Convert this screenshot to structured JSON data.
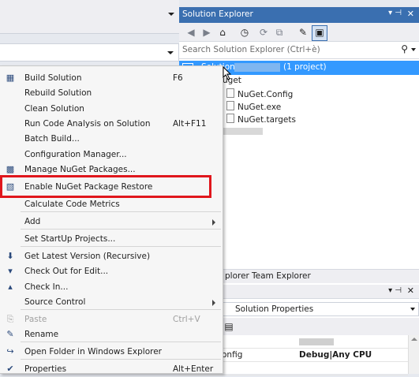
{
  "solution_explorer": {
    "title": "Solution Explorer",
    "pin_glyph": "▾ ⊣",
    "close_glyph": "✕",
    "search_placeholder": "Search Solution Explorer (Ctrl+è)",
    "solution_name": "Solution",
    "project_count": "(1 project)",
    "tree_items": [
      {
        "label": "uget"
      },
      {
        "label": "NuGet.Config"
      },
      {
        "label": "NuGet.exe"
      },
      {
        "label": "NuGet.targets"
      }
    ],
    "tabs": [
      "plorer",
      "Team Explorer"
    ]
  },
  "properties": {
    "header_label": "Solution Properties",
    "rows": [
      {
        "key": "",
        "value": ""
      },
      {
        "key": "onfig",
        "value": "Debug|Any CPU"
      },
      {
        "key": "",
        "value": ""
      }
    ]
  },
  "context_menu": {
    "items": [
      {
        "icon": "build-icon",
        "label": "Build Solution",
        "shortcut": "F6"
      },
      {
        "label": "Rebuild Solution"
      },
      {
        "label": "Clean Solution"
      },
      {
        "label": "Run Code Analysis on Solution",
        "shortcut": "Alt+F11"
      },
      {
        "label": "Batch Build..."
      },
      {
        "label": "Configuration Manager..."
      },
      {
        "icon": "nuget-icon",
        "label": "Manage NuGet Packages..."
      },
      {
        "icon": "package-restore-icon",
        "label": "Enable NuGet Package Restore"
      },
      {
        "label": "Calculate Code Metrics"
      },
      {
        "label": "Add"
      },
      {
        "label": "Set StartUp Projects..."
      },
      {
        "icon": "get-latest-icon",
        "label": "Get Latest Version (Recursive)"
      },
      {
        "icon": "check-out-icon",
        "label": "Check Out for Edit..."
      },
      {
        "icon": "check-in-icon",
        "label": "Check In..."
      },
      {
        "label": "Source Control"
      },
      {
        "icon": "paste-icon",
        "label": "Paste",
        "shortcut": "Ctrl+V"
      },
      {
        "icon": "rename-icon",
        "label": "Rename"
      },
      {
        "icon": "open-folder-icon",
        "label": "Open Folder in Windows Explorer"
      },
      {
        "icon": "properties-icon",
        "label": "Properties",
        "shortcut": "Alt+Enter"
      }
    ]
  },
  "colors": {
    "title_bar": "#3a6fb0",
    "selection": "#3399ff",
    "highlight_box": "#e0161c"
  }
}
